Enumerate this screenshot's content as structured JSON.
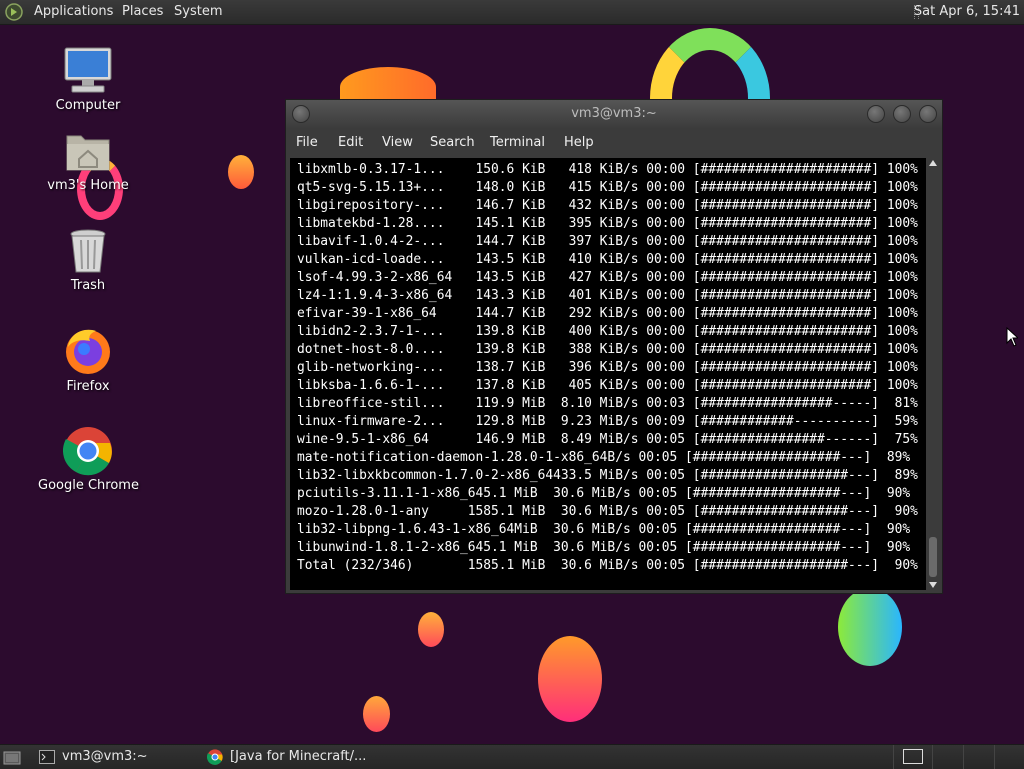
{
  "top_panel": {
    "menus": [
      "Applications",
      "Places",
      "System"
    ],
    "clock": "Sat Apr  6, 15:41"
  },
  "desktop_icons": [
    {
      "label": "Computer",
      "icon": "computer-icon"
    },
    {
      "label": "vm3's Home",
      "icon": "home-folder-icon"
    },
    {
      "label": "Trash",
      "icon": "trash-icon"
    },
    {
      "label": "Firefox",
      "icon": "firefox-icon"
    },
    {
      "label": "Google Chrome",
      "icon": "chrome-icon"
    }
  ],
  "terminal": {
    "title": "vm3@vm3:~",
    "menu": [
      "File",
      "Edit",
      "View",
      "Search",
      "Terminal",
      "Help"
    ],
    "lines": [
      "libxmlb-0.3.17-1...    150.6 KiB   418 KiB/s 00:00 [######################] 100%",
      "qt5-svg-5.15.13+...    148.0 KiB   415 KiB/s 00:00 [######################] 100%",
      "libgirepository-...    146.7 KiB   432 KiB/s 00:00 [######################] 100%",
      "libmatekbd-1.28....    145.1 KiB   395 KiB/s 00:00 [######################] 100%",
      "libavif-1.0.4-2-...    144.7 KiB   397 KiB/s 00:00 [######################] 100%",
      "vulkan-icd-loade...    143.5 KiB   410 KiB/s 00:00 [######################] 100%",
      "lsof-4.99.3-2-x86_64   143.5 KiB   427 KiB/s 00:00 [######################] 100%",
      "lz4-1:1.9.4-3-x86_64   143.3 KiB   401 KiB/s 00:00 [######################] 100%",
      "efivar-39-1-x86_64     144.7 KiB   292 KiB/s 00:00 [######################] 100%",
      "libidn2-2.3.7-1-...    139.8 KiB   400 KiB/s 00:00 [######################] 100%",
      "dotnet-host-8.0....    139.8 KiB   388 KiB/s 00:00 [######################] 100%",
      "glib-networking-...    138.7 KiB   396 KiB/s 00:00 [######################] 100%",
      "libksba-1.6.6-1-...    137.8 KiB   405 KiB/s 00:00 [######################] 100%",
      "libreoffice-stil...    119.9 MiB  8.10 MiB/s 00:03 [#################-----]  81%",
      "linux-firmware-2...    129.8 MiB  9.23 MiB/s 00:09 [############----------]  59%",
      "wine-9.5-1-x86_64      146.9 MiB  8.49 MiB/s 00:05 [################------]  75%",
      "mate-notification-daemon-1.28.0-1-x86_64B/s 00:05 [###################---]  89%",
      "lib32-libxkbcommon-1.7.0-2-x86_64433.5 MiB/s 00:05 [###################---]  89%",
      "pciutils-3.11.1-1-x86_645.1 MiB  30.6 MiB/s 00:05 [###################---]  90%",
      "mozo-1.28.0-1-any     1585.1 MiB  30.6 MiB/s 00:05 [###################---]  90%",
      "lib32-libpng-1.6.43-1-x86_64MiB  30.6 MiB/s 00:05 [###################---]  90%",
      "libunwind-1.8.1-2-x86_645.1 MiB  30.6 MiB/s 00:05 [###################---]  90%",
      "Total (232/346)       1585.1 MiB  30.6 MiB/s 00:05 [###################---]  90%"
    ]
  },
  "taskbar": {
    "tasks": [
      {
        "label": "vm3@vm3:~",
        "icon": "terminal-icon"
      },
      {
        "label": "[Java for Minecraft/...",
        "icon": "chrome-icon"
      }
    ]
  },
  "colors": {
    "desktop_bg": "#2c0b2e",
    "panel_bg": "#2d2d2d",
    "terminal_bg": "#000000",
    "terminal_fg": "#ffffff"
  }
}
